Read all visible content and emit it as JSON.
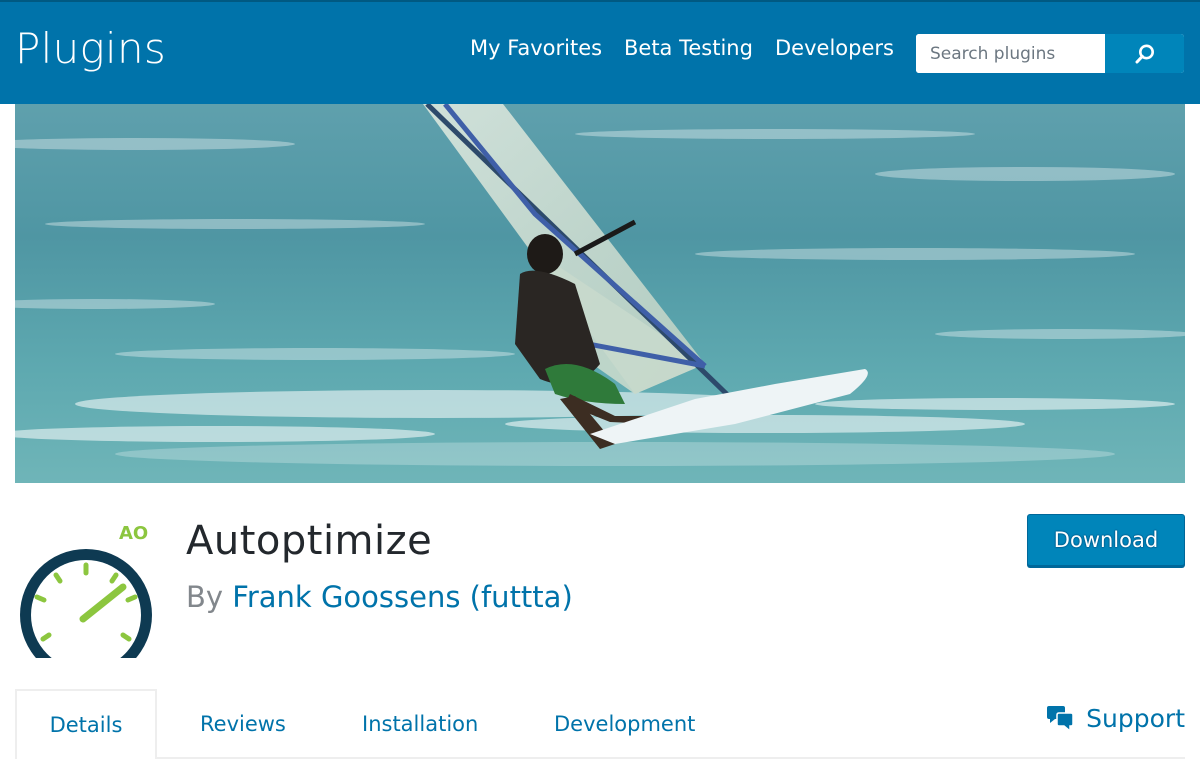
{
  "header": {
    "brand": "Plugins",
    "nav": [
      {
        "label": "My Favorites"
      },
      {
        "label": "Beta Testing"
      },
      {
        "label": "Developers"
      }
    ],
    "search": {
      "placeholder": "Search plugins",
      "icon": "search-icon"
    }
  },
  "banner": {
    "description": "windsurfer"
  },
  "plugin": {
    "icon_text": "AO",
    "title": "Autoptimize",
    "by_label": "By",
    "author": "Frank Goossens (futtta)",
    "download_label": "Download"
  },
  "tabs": [
    {
      "label": "Details",
      "active": true
    },
    {
      "label": "Reviews"
    },
    {
      "label": "Installation"
    },
    {
      "label": "Development"
    }
  ],
  "support": {
    "label": "Support",
    "icon": "comments-icon"
  },
  "colors": {
    "brand": "#0073aa",
    "button": "#0085ba",
    "icon_green": "#8cc63f",
    "icon_navy": "#0e3a52"
  }
}
